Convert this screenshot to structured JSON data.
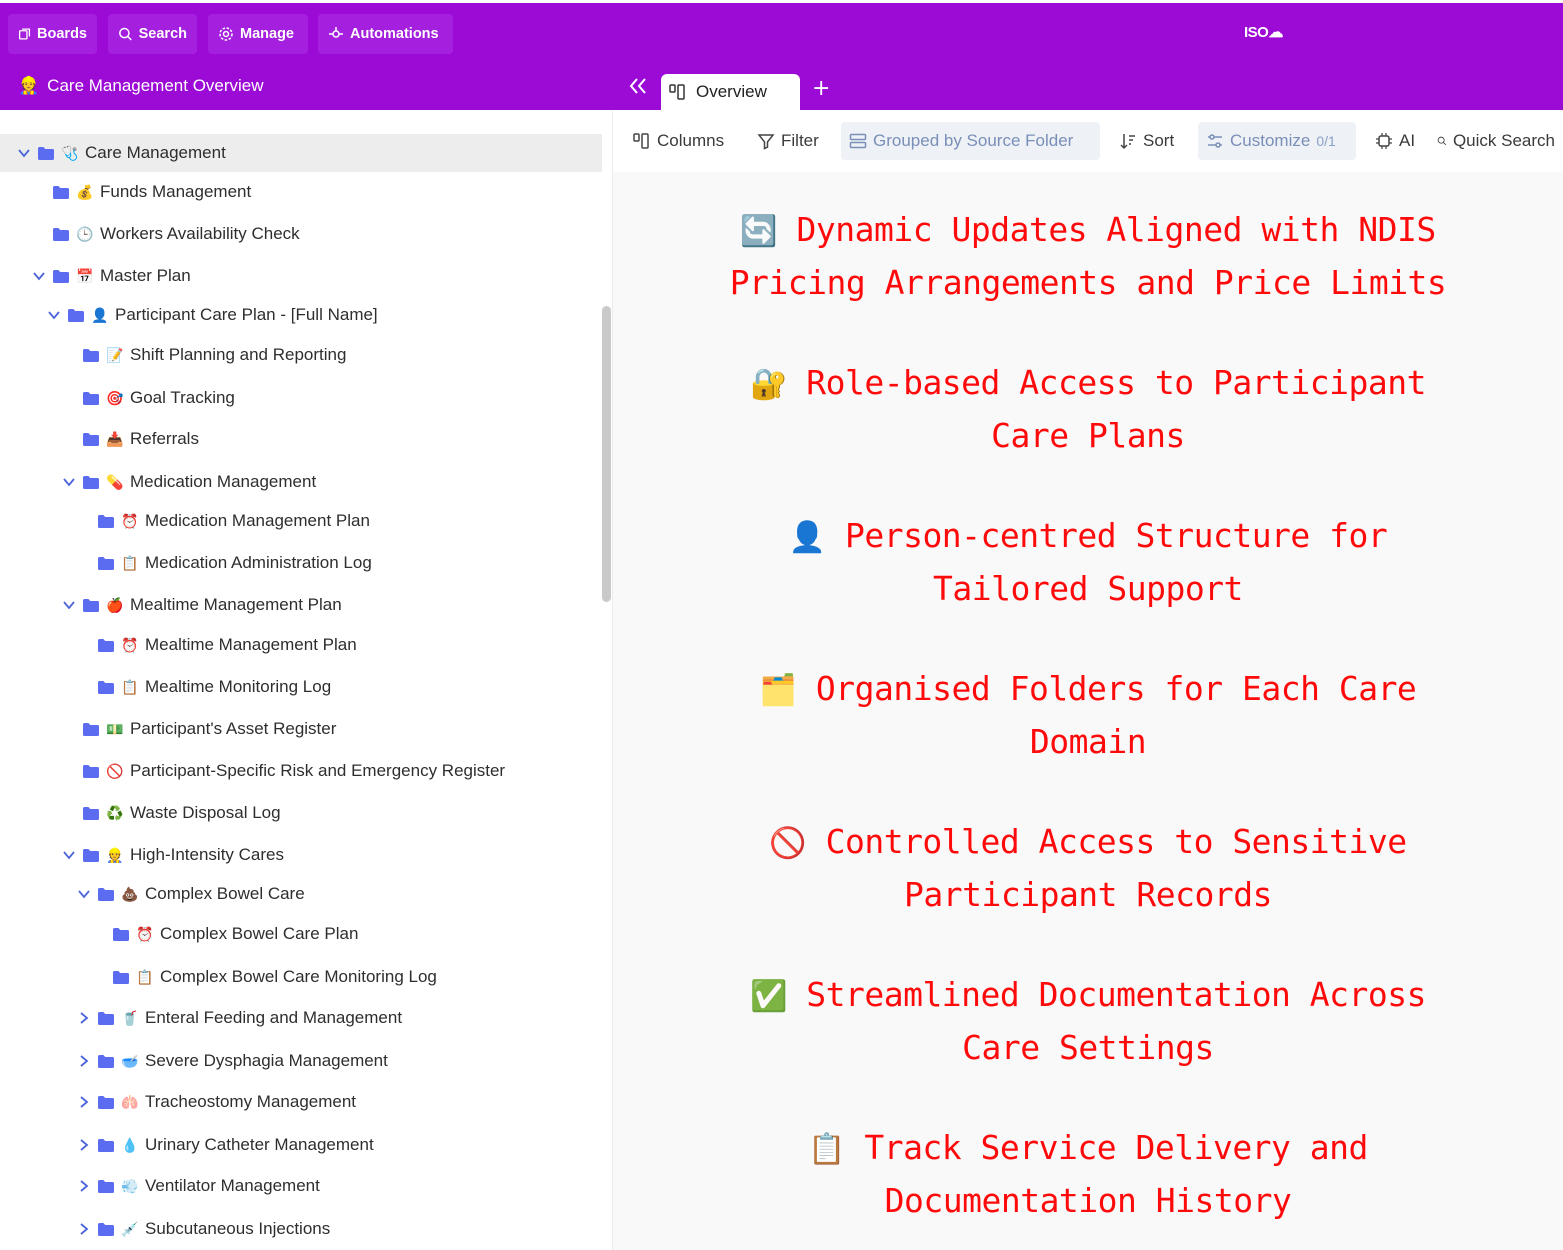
{
  "topbar": {
    "buttons": [
      {
        "label": "Boards",
        "icon": "boards-icon"
      },
      {
        "label": "Search",
        "icon": "search-icon"
      },
      {
        "label": "Manage",
        "icon": "gear-icon"
      },
      {
        "label": "Automations",
        "icon": "automation-icon"
      }
    ],
    "brand": "ISO"
  },
  "subbar": {
    "title_icon": "👷",
    "title": "Care Management Overview",
    "tab_label": "Overview",
    "add_tab": "+"
  },
  "tree": [
    {
      "label": "Care Management",
      "emoji": "🩺",
      "chevron": "down",
      "selected": true
    },
    {
      "label": "Funds Management",
      "emoji": "💰",
      "chevron": ""
    },
    {
      "label": "Workers Availability Check",
      "emoji": "🕒",
      "chevron": ""
    },
    {
      "label": "Master Plan",
      "emoji": "📅",
      "chevron": "down"
    },
    {
      "label": "Participant Care Plan - [Full Name]",
      "emoji": "👤",
      "chevron": "down"
    },
    {
      "label": "Shift Planning and Reporting",
      "emoji": "📝",
      "chevron": ""
    },
    {
      "label": "Goal Tracking",
      "emoji": "🎯",
      "chevron": ""
    },
    {
      "label": "Referrals",
      "emoji": "📥",
      "chevron": ""
    },
    {
      "label": "Medication Management",
      "emoji": "💊",
      "chevron": "down"
    },
    {
      "label": "Medication Management Plan",
      "emoji": "⏰",
      "chevron": ""
    },
    {
      "label": "Medication Administration Log",
      "emoji": "📋",
      "chevron": ""
    },
    {
      "label": "Mealtime Management Plan",
      "emoji": "🍎",
      "chevron": "down"
    },
    {
      "label": "Mealtime Management Plan",
      "emoji": "⏰",
      "chevron": ""
    },
    {
      "label": "Mealtime Monitoring Log",
      "emoji": "📋",
      "chevron": ""
    },
    {
      "label": "Participant's Asset Register",
      "emoji": "💵",
      "chevron": ""
    },
    {
      "label": "Participant-Specific Risk and Emergency Register",
      "emoji": "🚫",
      "chevron": ""
    },
    {
      "label": "Waste Disposal Log",
      "emoji": "♻️",
      "chevron": ""
    },
    {
      "label": "High-Intensity Cares",
      "emoji": "👷",
      "chevron": "down"
    },
    {
      "label": "Complex Bowel Care",
      "emoji": "💩",
      "chevron": "down"
    },
    {
      "label": "Complex Bowel Care Plan",
      "emoji": "⏰",
      "chevron": ""
    },
    {
      "label": "Complex Bowel Care Monitoring Log",
      "emoji": "📋",
      "chevron": ""
    },
    {
      "label": "Enteral Feeding and Management",
      "emoji": "🥤",
      "chevron": "right"
    },
    {
      "label": "Severe Dysphagia Management",
      "emoji": "🥣",
      "chevron": "right"
    },
    {
      "label": "Tracheostomy Management",
      "emoji": "🫁",
      "chevron": "right"
    },
    {
      "label": "Urinary Catheter Management",
      "emoji": "💧",
      "chevron": "right"
    },
    {
      "label": "Ventilator Management",
      "emoji": "💨",
      "chevron": "right"
    },
    {
      "label": "Subcutaneous Injections",
      "emoji": "💉",
      "chevron": "right"
    }
  ],
  "toolbar": {
    "columns": "Columns",
    "filter": "Filter",
    "grouped": "Grouped by Source Folder",
    "sort": "Sort",
    "customize": "Customize",
    "customize_count": "0/1",
    "ai": "AI",
    "quick_search": "Quick Search"
  },
  "features": [
    {
      "icon": "🔄",
      "text": "Dynamic Updates Aligned with NDIS Pricing Arrangements and Price Limits"
    },
    {
      "icon": "🔐",
      "text": "Role-based Access to Participant Care Plans"
    },
    {
      "icon": "👤",
      "text": "Person-centred Structure for Tailored Support"
    },
    {
      "icon": "🗂️",
      "text": "Organised Folders for Each Care Domain"
    },
    {
      "icon": "🚫",
      "text": "Controlled Access to Sensitive Participant Records"
    },
    {
      "icon": "✅",
      "text": "Streamlined Documentation Across Care Settings"
    },
    {
      "icon": "📋",
      "text": "Track Service Delivery and Documentation History"
    }
  ],
  "colors": {
    "topbar": "#9c0ad6",
    "folder": "#5b6cf0",
    "feature_text": "#ff0a0a"
  }
}
